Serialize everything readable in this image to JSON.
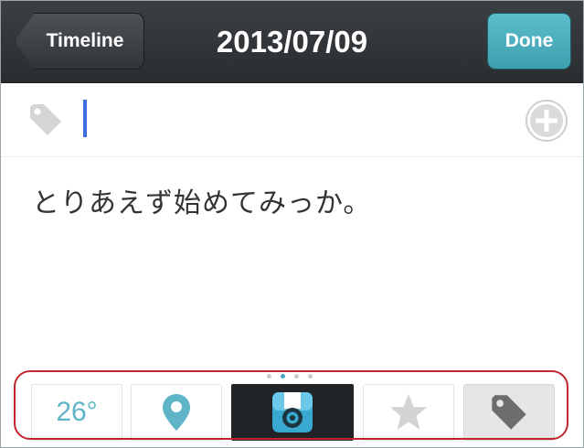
{
  "navbar": {
    "back_label": "Timeline",
    "title": "2013/07/09",
    "done_label": "Done"
  },
  "tag_row": {
    "icon": "tag-icon",
    "input_value": "",
    "add_icon": "plus-circle-icon"
  },
  "note": {
    "text": "とりあえず始めてみっか。"
  },
  "pager": {
    "total": 4,
    "active_index": 1
  },
  "toolbar": {
    "weather_label": "26°",
    "location_icon": "location-pin-icon",
    "photo_icon": "camera-icon",
    "star_icon": "star-icon",
    "tag_icon": "tag-icon"
  },
  "colors": {
    "accent": "#47a6c4",
    "done_button": "#4fb0be",
    "navbar": "#2f3236",
    "highlight": "#c0272d"
  }
}
